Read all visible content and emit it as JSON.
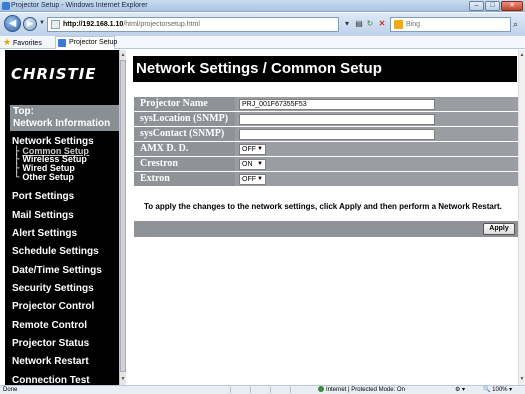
{
  "window": {
    "title": "Projector Setup - Windows Internet Explorer",
    "controls": {
      "minimize": "–",
      "maximize": "□",
      "close": "✕"
    }
  },
  "addressbar": {
    "url_host": "http://192.168.1.10",
    "url_path": "/html/projectorsetup.html",
    "search_placeholder": "Bing",
    "icons": [
      "back-arrow-icon",
      "forward-arrow-icon",
      "refresh-icon",
      "stop-icon",
      "search-icon"
    ]
  },
  "favorites": {
    "label": "Favorites",
    "tab_label": "Projector Setup"
  },
  "sidebar": {
    "logo": "CHRISTIE",
    "top_link": {
      "line1": "Top:",
      "line2": "Network Information"
    },
    "network_settings": {
      "label": "Network Settings",
      "subitems": [
        {
          "label": "Common Setup",
          "tree": "├"
        },
        {
          "label": "Wireless Setup",
          "tree": "├"
        },
        {
          "label": "Wired Setup",
          "tree": "├"
        },
        {
          "label": "Other Setup",
          "tree": "└"
        }
      ]
    },
    "items": [
      "Port Settings",
      "Mail Settings",
      "Alert Settings",
      "Schedule Settings",
      "Date/Time Settings",
      "Security Settings",
      "Projector Control",
      "Remote Control",
      "Projector Status",
      "Network Restart",
      "Connection Test"
    ]
  },
  "main": {
    "title": "Network Settings / Common Setup",
    "fields": [
      {
        "label": "Projector Name",
        "value": "PRJ_001F67355F53"
      },
      {
        "label": "sysLocation (SNMP)",
        "value": ""
      },
      {
        "label": "sysContact (SNMP)",
        "value": ""
      }
    ],
    "selects": [
      {
        "label": "AMX D. D.",
        "value": "OFF"
      },
      {
        "label": "Crestron",
        "value": "ON"
      },
      {
        "label": "Extron",
        "value": "OFF"
      }
    ],
    "instruction": "To apply the changes to the network settings, click Apply and then perform a Network Restart.",
    "apply_label": "Apply"
  },
  "statusbar": {
    "left": "Done",
    "zone": "Internet | Protected Mode: On",
    "zoom": "100%"
  },
  "colors": {
    "sidebar_bg": "#000000",
    "label_bg": "#8f9398",
    "header_bg": "#000000"
  }
}
